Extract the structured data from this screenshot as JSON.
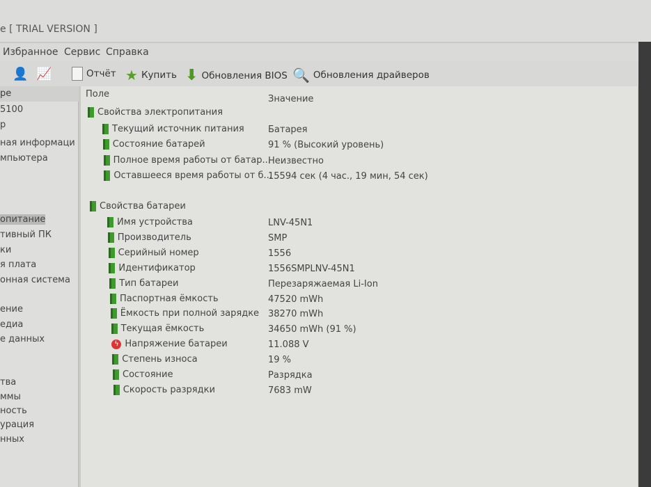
{
  "title": "e [ TRIAL VERSION ]",
  "menu": [
    "Избранное",
    "Сервис",
    "Справка"
  ],
  "toolbar": {
    "report": "Отчёт",
    "buy": "Купить",
    "bios": "Обновления BIOS",
    "drivers": "Обновления драйверов"
  },
  "sidebar": {
    "header": "ре",
    "items": [
      "5100",
      "р",
      "ная информаци",
      "мпьютера",
      "опитание",
      "тивный ПК",
      "ки",
      "я плата",
      "онная система",
      "ение",
      "едиа",
      "е данных",
      "тва",
      "ммы",
      "ность",
      "урация",
      "нных"
    ]
  },
  "columns": {
    "field": "Поле",
    "value": "Значение"
  },
  "sections": [
    {
      "title": "Свойства электропитания",
      "rows": [
        {
          "field": "Текущий источник питания",
          "value": "Батарея"
        },
        {
          "field": "Состояние батарей",
          "value": "91 % (Высокий уровень)"
        },
        {
          "field": "Полное время работы от батар...",
          "value": "Неизвестно"
        },
        {
          "field": "Оставшееся время работы от б...",
          "value": "15594 сек (4 час., 19 мин, 54 сек)"
        }
      ]
    },
    {
      "title": "Свойства батареи",
      "rows": [
        {
          "field": "Имя устройства",
          "value": "LNV-45N1"
        },
        {
          "field": "Производитель",
          "value": "SMP"
        },
        {
          "field": "Серийный номер",
          "value": "1556"
        },
        {
          "field": "Идентификатор",
          "value": "1556SMPLNV-45N1"
        },
        {
          "field": "Тип батареи",
          "value": "Перезаряжаемая Li-Ion"
        },
        {
          "field": "Паспортная ёмкость",
          "value": "47520 mWh"
        },
        {
          "field": "Ёмкость при полной зарядке",
          "value": "38270 mWh"
        },
        {
          "field": "Текущая ёмкость",
          "value": "34650 mWh  (91 %)"
        },
        {
          "field": "Напряжение батареи",
          "value": "11.088 V"
        },
        {
          "field": "Степень износа",
          "value": "19 %"
        },
        {
          "field": "Состояние",
          "value": "Разрядка"
        },
        {
          "field": "Скорость разрядки",
          "value": "7683 mW"
        }
      ]
    }
  ]
}
